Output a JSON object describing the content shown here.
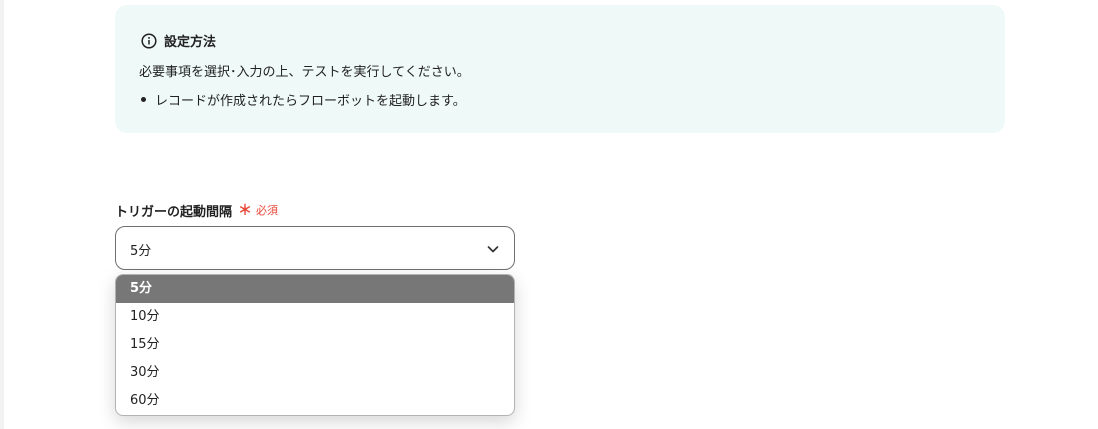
{
  "info": {
    "icon": "info-circle-icon",
    "title": "設定方法",
    "description": "必要事項を選択･入力の上、テストを実行してください。",
    "bullets": [
      "レコードが作成されたらフローボットを起動します。"
    ],
    "background": "#eff9f8"
  },
  "field": {
    "label": "トリガーの起動間隔",
    "required_mark": "＊",
    "required_text": "必須",
    "required_color": "#e8483b",
    "selected_value": "5分",
    "chevron_icon": "chevron-down-icon"
  },
  "dropdown": {
    "options": [
      "5分",
      "10分",
      "15分",
      "30分",
      "60分"
    ],
    "highlighted_index": 0,
    "highlight_color": "#777777"
  }
}
